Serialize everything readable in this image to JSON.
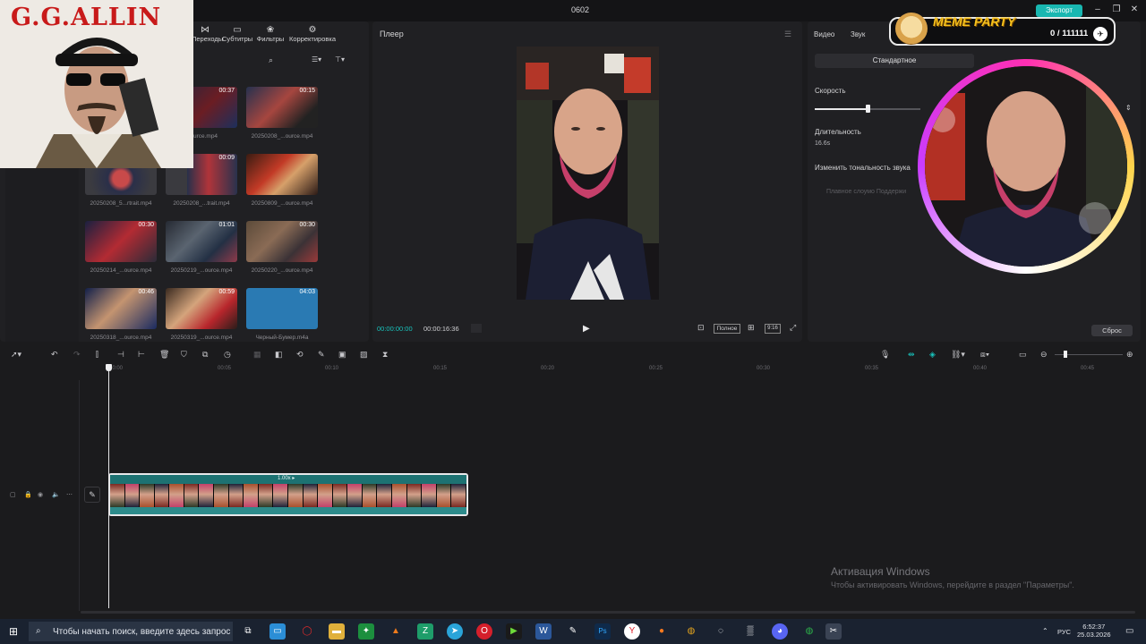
{
  "window": {
    "title": "0602",
    "export_label": "Экспорт"
  },
  "media": {
    "tools": [
      {
        "label": "Переходы",
        "icon": "transitions-icon"
      },
      {
        "label": "Субтитры",
        "icon": "subtitles-icon"
      },
      {
        "label": "Фильтры",
        "icon": "filters-icon"
      },
      {
        "label": "Корректировка",
        "icon": "adjust-icon"
      }
    ],
    "clips": [
      {
        "name": "...ource.mp4",
        "duration": "00:37"
      },
      {
        "name": "20250208_...ource.mp4",
        "duration": "00:15"
      },
      {
        "name": "20250208_5...rtrait.mp4",
        "duration": ""
      },
      {
        "name": "20250208_...trait.mp4",
        "duration": "00:09"
      },
      {
        "name": "20250809_...ource.mp4",
        "duration": ""
      },
      {
        "name": "20250214_...ource.mp4",
        "duration": "00:30"
      },
      {
        "name": "20250219_...ource.mp4",
        "duration": "01:01"
      },
      {
        "name": "20250220_...ource.mp4",
        "duration": "00:30"
      },
      {
        "name": "20250318_...ource.mp4",
        "duration": "00:46"
      },
      {
        "name": "20250319_...ource.mp4",
        "duration": "00:59"
      },
      {
        "name": "Черный-Бумер.m4a",
        "duration": "04:03"
      }
    ]
  },
  "overlay": {
    "gg_title": "G.G.ALLIN"
  },
  "player": {
    "title": "Плеер",
    "current_time": "00:00:00:00",
    "total_time": "00:00:16:36",
    "full_label": "Полное",
    "ratio_label": "9:16"
  },
  "inspector": {
    "tabs": [
      "Видео",
      "Звук"
    ],
    "segment": "Стандартное",
    "speed_label": "Скорость",
    "speed_level_percent": 50,
    "duration_label": "Длительность",
    "duration_value": "16.6s",
    "pitch_label": "Изменить тональность звука",
    "smooth_label": "Плавное слоумо Поддержи",
    "reset_label": "Сброс"
  },
  "meme": {
    "title": "MEME PARTY",
    "counter": "0 / 111111"
  },
  "timeline": {
    "ticks": [
      "00:00",
      "00:05",
      "00:10",
      "00:15",
      "00:20",
      "00:25",
      "00:30",
      "00:35",
      "00:40",
      "00:45"
    ],
    "speed_badge": "1.00x ▸"
  },
  "watermark": {
    "title": "Активация Windows",
    "subtitle": "Чтобы активировать Windows, перейдите в раздел \"Параметры\"."
  },
  "taskbar": {
    "search_placeholder": "Чтобы начать поиск, введите здесь запрос",
    "lang": "РУС",
    "time": "6:52:37",
    "date": "25.03.2026"
  },
  "colors": {
    "accent": "#18c3bc",
    "export": "#19b7b1",
    "meme_gold": "#f7c21d",
    "track": "#1e6a6a"
  }
}
